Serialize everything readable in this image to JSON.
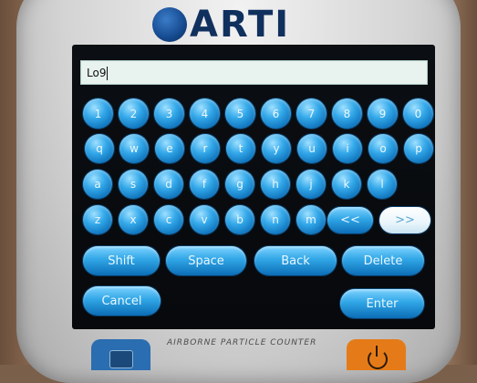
{
  "brand": {
    "logo_text": "ARTI"
  },
  "input": {
    "value": "Lo9"
  },
  "keyboard": {
    "row1": [
      "1",
      "2",
      "3",
      "4",
      "5",
      "6",
      "7",
      "8",
      "9",
      "0"
    ],
    "row2": [
      "q",
      "w",
      "e",
      "r",
      "t",
      "y",
      "u",
      "i",
      "o",
      "p"
    ],
    "row3": [
      "a",
      "s",
      "d",
      "f",
      "g",
      "h",
      "j",
      "k",
      "l"
    ],
    "row4": [
      "z",
      "x",
      "c",
      "v",
      "b",
      "n",
      "m"
    ],
    "prev_label": "<<",
    "next_label": ">>",
    "shift_label": "Shift",
    "space_label": "Space",
    "back_label": "Back",
    "delete_label": "Delete",
    "cancel_label": "Cancel",
    "enter_label": "Enter"
  },
  "device_label": "AIRBORNE PARTICLE COUNTER",
  "hardware_buttons": {
    "left_icon": "menu-icon",
    "right_icon": "power-icon"
  }
}
